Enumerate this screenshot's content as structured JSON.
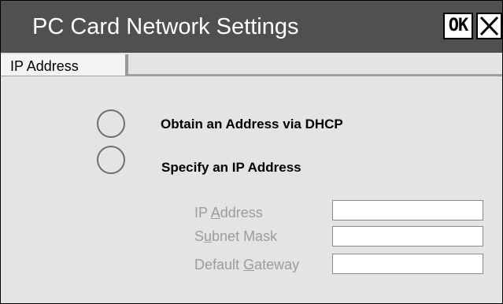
{
  "window": {
    "title": "PC Card Network Settings",
    "ok_label": "OK",
    "close_icon": "close-x-icon"
  },
  "tabs": [
    {
      "label": "IP Address",
      "selected": true
    }
  ],
  "options": {
    "dhcp_label": "Obtain an Address via DHCP",
    "static_label": "Specify an IP Address",
    "selected": null
  },
  "fields": {
    "ip_address": {
      "label_pre": "IP ",
      "label_accel": "A",
      "label_post": "ddress",
      "value": ""
    },
    "subnet_mask": {
      "label_pre": "S",
      "label_accel": "u",
      "label_post": "bnet Mask",
      "value": ""
    },
    "default_gateway": {
      "label_pre": "Default ",
      "label_accel": "G",
      "label_post": "ateway",
      "value": ""
    }
  },
  "colors": {
    "titlebar": "#505050",
    "background": "#e4e4e4",
    "disabled_text": "#9c9c9c"
  }
}
